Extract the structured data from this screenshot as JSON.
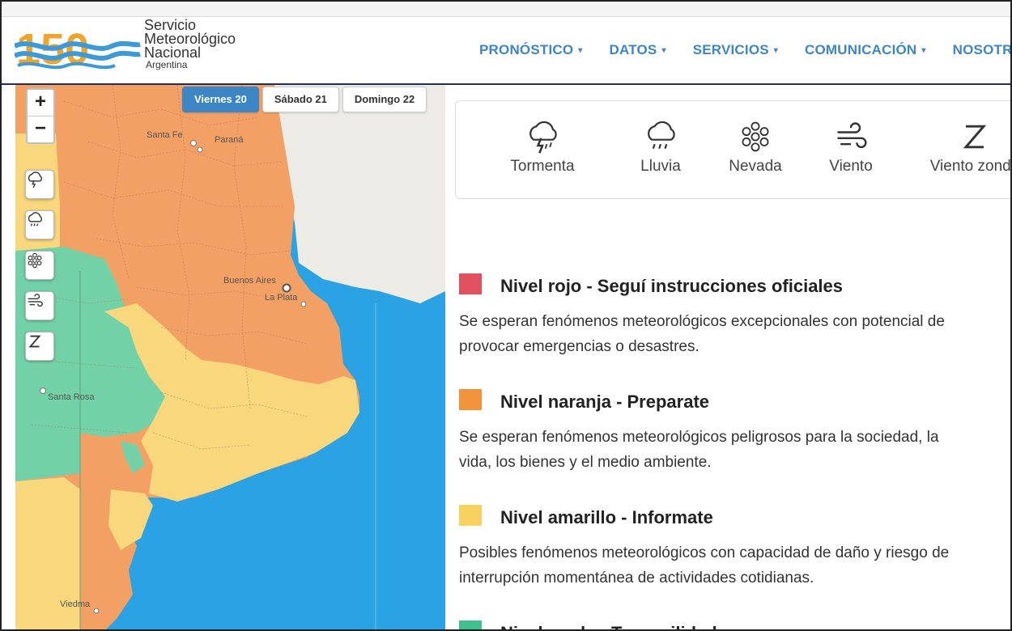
{
  "header": {
    "logo_number": "150",
    "logo_line1": "Servicio",
    "logo_line2": "Meteorológico",
    "logo_line3": "Nacional",
    "logo_line4": "Argentina",
    "nav": [
      "PRONÓSTICO",
      "DATOS",
      "SERVICIOS",
      "COMUNICACIÓN",
      "NOSOTROS"
    ],
    "nav_caret": "▾"
  },
  "map": {
    "zoom_in": "+",
    "zoom_out": "−",
    "days": [
      "Viernes 20",
      "Sábado 21",
      "Domingo 22"
    ],
    "active_day": "Viernes 20",
    "labels": [
      "Santa Fe",
      "Paraná",
      "Buenos Aires",
      "La Plata",
      "Santa Rosa",
      "Viedma"
    ],
    "side_tools": [
      "storm-icon",
      "rain-icon",
      "snow-icon",
      "wind-icon",
      "zonda-icon"
    ],
    "colors": {
      "orange": "#f3a064",
      "yellow": "#f8d77d",
      "green": "#73d1a8",
      "sea": "#2aa2e3",
      "uruguay": "#ecebe6"
    }
  },
  "phenomena": [
    "Tormenta",
    "Lluvia",
    "Nevada",
    "Viento",
    "Viento zonda"
  ],
  "levels": [
    {
      "color": "#e0505f",
      "title": "Nivel rojo - Seguí instrucciones oficiales",
      "desc1": "Se esperan fenómenos meteorológicos excepcionales con potencial de",
      "desc2": "provocar emergencias o desastres."
    },
    {
      "color": "#f0933a",
      "title": "Nivel naranja - Preparate",
      "desc1": "Se esperan fenómenos meteorológicos peligrosos para la sociedad, la",
      "desc2": "vida, los bienes y el medio ambiente."
    },
    {
      "color": "#f8d260",
      "title": "Nivel amarillo - Informate",
      "desc1": "Posibles fenómenos meteorológicos con capacidad de daño y riesgo de",
      "desc2": "interrupción momentánea de actividades cotidianas."
    },
    {
      "color": "#3fc08f",
      "title": "Nivel verde - Tranquilidad"
    }
  ]
}
